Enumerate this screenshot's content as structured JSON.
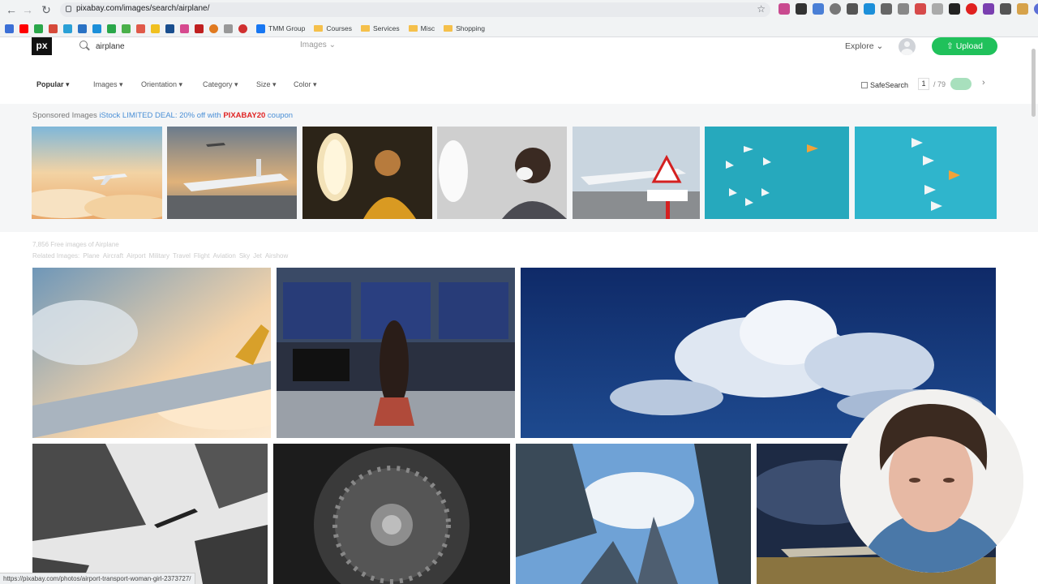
{
  "browser": {
    "url": "pixabay.com/images/search/airplane/",
    "status_url": "https://pixabay.com/photos/airport-transport-woman-girl-2373727/",
    "bookmarks": [
      {
        "label": "TMM Group"
      },
      {
        "label": "Courses"
      },
      {
        "label": "Services"
      },
      {
        "label": "Misc"
      },
      {
        "label": "Shopping"
      }
    ],
    "colors": {
      "chrome_bg": "#f1f3f4"
    }
  },
  "header": {
    "logo": "px",
    "search_value": "airplane",
    "search_type": "Images",
    "explore_label": "Explore",
    "upload_label": "Upload"
  },
  "filters": {
    "sort": "Popular",
    "items": [
      "Images",
      "Orientation",
      "Category",
      "Size",
      "Color"
    ],
    "safesearch_label": "SafeSearch",
    "page_current": "1",
    "page_total": "/ 79"
  },
  "sponsored": {
    "prefix": "Sponsored Images ",
    "brand": "iStock",
    "deal": " LIMITED DEAL: 20% off with ",
    "code": "PIXABAY20",
    "suffix": " coupon"
  },
  "results": {
    "count_text": "7,856 Free images of Airplane",
    "related_label": "Related Images:",
    "related": [
      "Plane",
      "Aircraft",
      "Airport",
      "Military",
      "Travel",
      "Flight",
      "Aviation",
      "Sky",
      "Jet",
      "Airshow"
    ]
  },
  "icons": [
    "back-icon",
    "forward-icon",
    "reload-icon",
    "star-icon",
    "search-icon",
    "chevron-down-icon",
    "upload-icon",
    "user-icon",
    "next-page-icon"
  ],
  "brand_colors": {
    "upload_green": "#20c15b",
    "sponsor_code_red": "#e02424",
    "sponsor_link_blue": "#4a8fd6"
  }
}
